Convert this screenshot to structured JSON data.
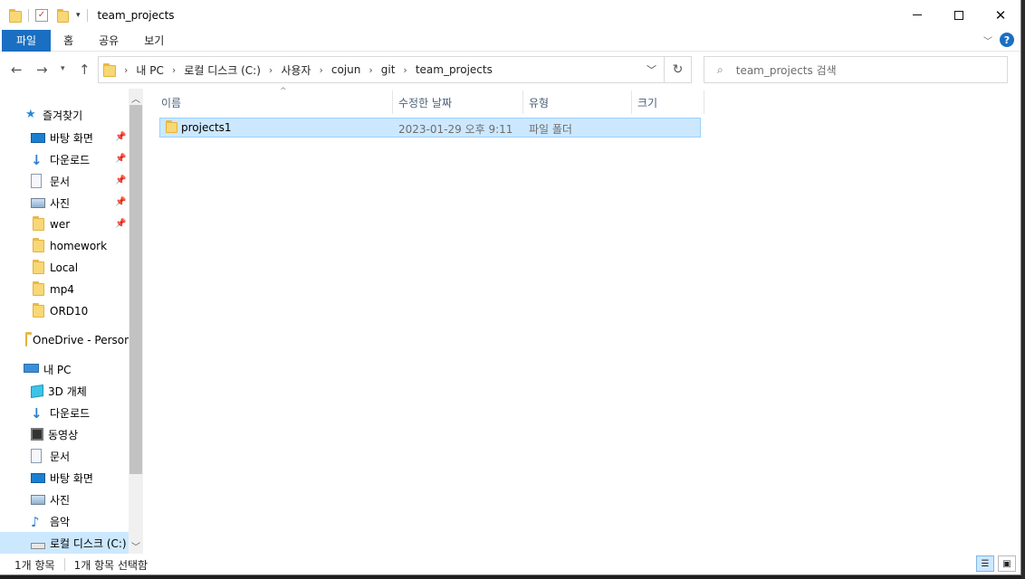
{
  "window": {
    "title": "team_projects"
  },
  "ribbon": {
    "tabs": [
      "파일",
      "홈",
      "공유",
      "보기"
    ]
  },
  "address": {
    "crumbs": [
      "내 PC",
      "로컬 디스크 (C:)",
      "사용자",
      "cojun",
      "git",
      "team_projects"
    ]
  },
  "search": {
    "placeholder": "team_projects 검색"
  },
  "nav": {
    "items": [
      {
        "label": "즐겨찾기",
        "icon": "star-icon"
      },
      {
        "label": "바탕 화면",
        "icon": "desktop-icon",
        "pinned": true
      },
      {
        "label": "다운로드",
        "icon": "download-icon",
        "pinned": true
      },
      {
        "label": "문서",
        "icon": "document-icon",
        "pinned": true
      },
      {
        "label": "사진",
        "icon": "picture-icon",
        "pinned": true
      },
      {
        "label": "wer",
        "icon": "folder-icon",
        "pinned": true
      },
      {
        "label": "homework",
        "icon": "folder-icon"
      },
      {
        "label": "Local",
        "icon": "folder-icon"
      },
      {
        "label": "mp4",
        "icon": "folder-icon"
      },
      {
        "label": "ORD10",
        "icon": "folder-icon"
      },
      {
        "label": "OneDrive - Personal",
        "icon": "folder-icon"
      },
      {
        "label": "내 PC",
        "icon": "computer-icon"
      },
      {
        "label": "3D 개체",
        "icon": "3d-objects-icon"
      },
      {
        "label": "다운로드",
        "icon": "download-icon"
      },
      {
        "label": "동영상",
        "icon": "video-icon"
      },
      {
        "label": "문서",
        "icon": "document-icon"
      },
      {
        "label": "바탕 화면",
        "icon": "desktop-icon"
      },
      {
        "label": "사진",
        "icon": "picture-icon"
      },
      {
        "label": "음악",
        "icon": "music-icon"
      },
      {
        "label": "로컬 디스크 (C:)",
        "icon": "drive-icon",
        "selected": true
      }
    ]
  },
  "columns": {
    "name": "이름",
    "date": "수정한 날짜",
    "type": "유형",
    "size": "크기"
  },
  "files": [
    {
      "name": "projects1",
      "date": "2023-01-29 오후 9:11",
      "type": "파일 폴더",
      "size": ""
    }
  ],
  "status": {
    "count": "1개 항목",
    "selected": "1개 항목 선택함"
  },
  "colors": {
    "accent": "#1a6fc2",
    "selection": "#cce8ff",
    "folder": "#f8d775"
  }
}
